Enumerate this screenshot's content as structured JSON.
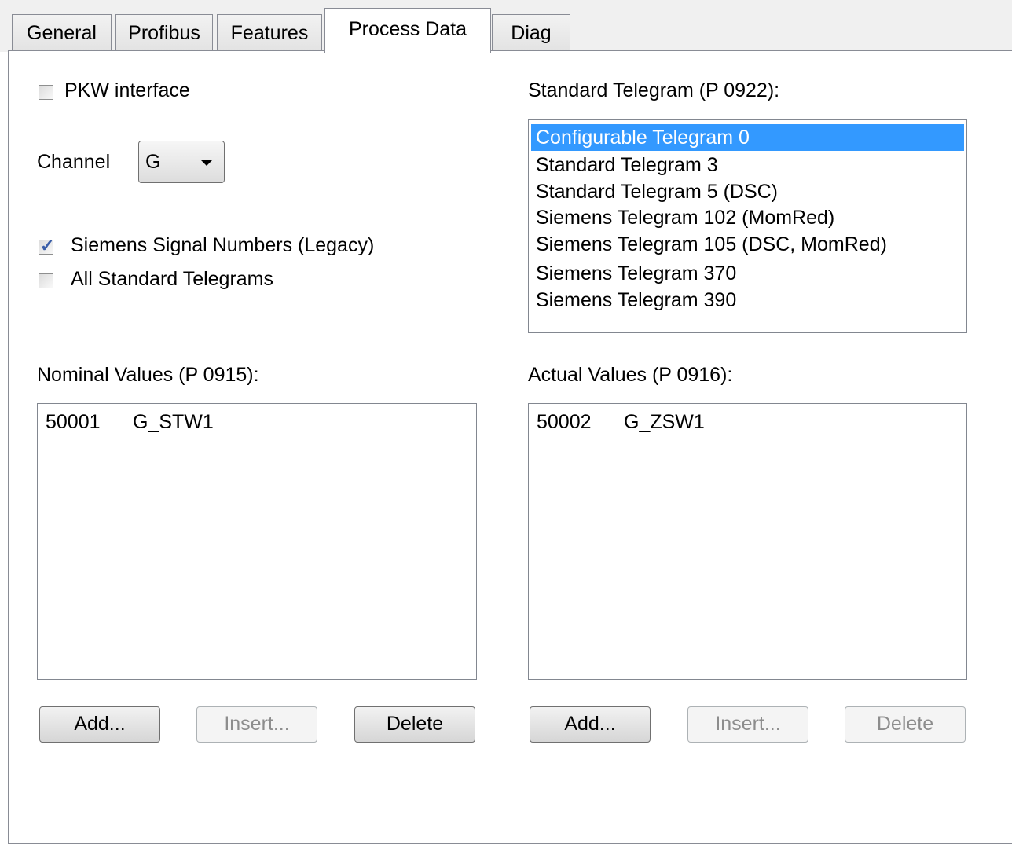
{
  "tabs": [
    {
      "label": "General"
    },
    {
      "label": "Profibus"
    },
    {
      "label": "Features"
    },
    {
      "label": "Process Data"
    },
    {
      "label": "Diag"
    }
  ],
  "active_tab": "Process Data",
  "pkw": {
    "label": "PKW interface",
    "checked": false
  },
  "channel": {
    "label": "Channel",
    "value": "G"
  },
  "siemens_signal": {
    "label": "Siemens Signal Numbers (Legacy)",
    "checked": true
  },
  "all_standard": {
    "label": "All Standard Telegrams",
    "checked": false
  },
  "telegram": {
    "label": "Standard Telegram (P 0922):",
    "items": [
      {
        "text": "Configurable Telegram 0",
        "selected": true
      },
      {
        "text": "Standard Telegram 3"
      },
      {
        "text": "Standard Telegram 5 (DSC)"
      },
      {
        "text": "Siemens Telegram 102 (MomRed)"
      },
      {
        "text": "Siemens Telegram 105 (DSC, MomRed)"
      },
      {
        "text": "Siemens Telegram 370"
      },
      {
        "text": "Siemens Telegram 390"
      }
    ]
  },
  "nominal": {
    "label": "Nominal Values (P 0915):",
    "rows": [
      {
        "code": "50001",
        "name": "G_STW1"
      }
    ],
    "add": "Add...",
    "insert": "Insert...",
    "delete": "Delete"
  },
  "actual": {
    "label": "Actual Values (P 0916):",
    "rows": [
      {
        "code": "50002",
        "name": "G_ZSW1"
      }
    ],
    "add": "Add...",
    "insert": "Insert...",
    "delete": "Delete"
  },
  "colors": {
    "selection": "#3399ff",
    "tab_border": "#898c95"
  }
}
